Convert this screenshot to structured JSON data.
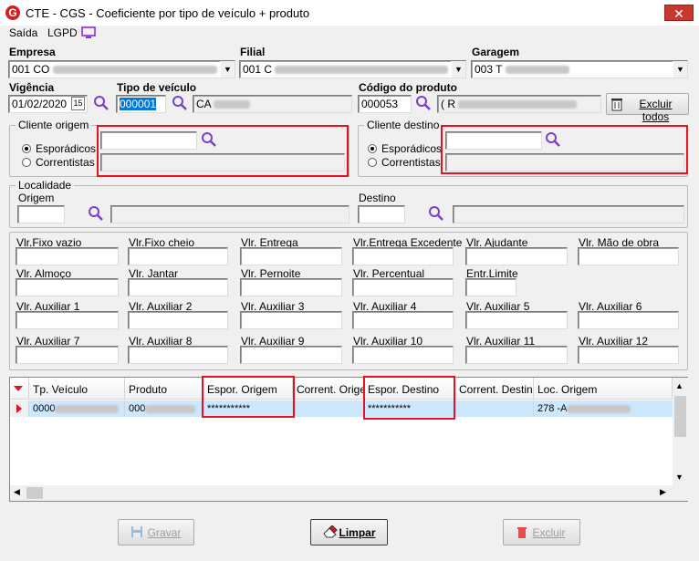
{
  "window": {
    "title": "CTE - CGS - Coeficiente por tipo de veículo + produto",
    "close": "✕"
  },
  "menu": {
    "saida": "Saída",
    "lgpd": "LGPD"
  },
  "header": {
    "empresa_label": "Empresa",
    "empresa_value": "001 CO",
    "filial_label": "Filial",
    "filial_value": "001 C",
    "garagem_label": "Garagem",
    "garagem_value": "003 T",
    "vigencia_label": "Vigência",
    "vigencia_value": "01/02/2020",
    "calendar_label": "15",
    "tipo_veiculo_label": "Tipo de veículo",
    "tipo_veiculo_code": "000001",
    "tipo_veiculo_desc": "CA",
    "codigo_produto_label": "Código do produto",
    "codigo_produto_value": "000053",
    "produto_desc": "( R",
    "excluir_todos": "Excluir todos"
  },
  "cliente_origem": {
    "title": "Cliente origem",
    "opt1": "Esporádicos",
    "opt2": "Correntistas",
    "selected": "Esporádicos"
  },
  "cliente_destino": {
    "title": "Cliente destino",
    "opt1": "Esporádicos",
    "opt2": "Correntistas",
    "selected": "Esporádicos"
  },
  "localidade": {
    "title": "Localidade",
    "origem_label": "Origem",
    "destino_label": "Destino"
  },
  "values": {
    "row1": [
      "Vlr.Fixo vazio",
      "Vlr.Fixo cheio",
      "Vlr. Entrega",
      "Vlr.Entrega Excedente",
      "Vlr. Ajudante",
      "Vlr. Mão de obra"
    ],
    "row2": [
      "Vlr. Almoço",
      "Vlr. Jantar",
      "Vlr. Pernoite",
      "Vlr. Percentual",
      "Entr.Limite"
    ],
    "row3": [
      "Vlr. Auxiliar 1",
      "Vlr. Auxiliar 2",
      "Vlr. Auxiliar 3",
      "Vlr. Auxiliar 4",
      "Vlr. Auxiliar 5",
      "Vlr. Auxiliar 6"
    ],
    "row4": [
      "Vlr. Auxiliar 7",
      "Vlr. Auxiliar 8",
      "Vlr. Auxiliar 9",
      "Vlr. Auxiliar 10",
      "Vlr. Auxiliar 11",
      "Vlr. Auxiliar 12"
    ]
  },
  "grid": {
    "columns": [
      "Tp. Veículo",
      "Produto",
      "Espor. Origem",
      "Corrent. Origem",
      "Espor. Destino",
      "Corrent. Destino",
      "Loc. Origem"
    ],
    "row": {
      "tp_veiculo": "0000",
      "produto": "000",
      "espor_origem": "***********",
      "corrent_origem": "",
      "espor_destino": "***********",
      "corrent_destino": "",
      "loc_origem": "278    -A"
    }
  },
  "footer": {
    "gravar": "Gravar",
    "limpar": "Limpar",
    "excluir": "Excluir"
  },
  "colors": {
    "highlight": "#e81123",
    "selection": "#cce8ff",
    "accent": "#0078d7"
  }
}
